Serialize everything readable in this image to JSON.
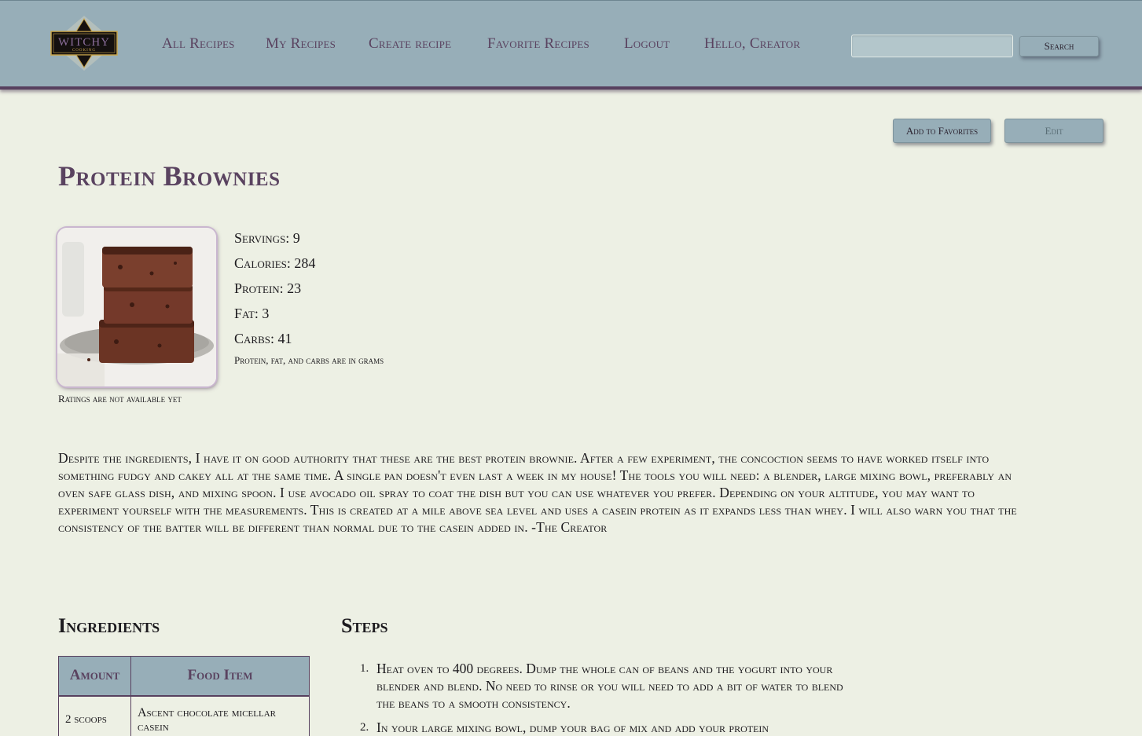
{
  "nav": {
    "logo_text": "Witchy Cooking",
    "links": [
      "All Recipes",
      "My Recipes",
      "Create recipe",
      "Favorite Recipes",
      "Logout",
      "Hello, Creator"
    ],
    "search_placeholder": "",
    "search_button": "Search"
  },
  "actions": {
    "favorite": "Add to Favorites",
    "edit": "Edit"
  },
  "recipe": {
    "title": "Protein Brownies",
    "ratings": "Ratings are not available yet",
    "stats": {
      "servings": "Servings: 9",
      "calories": "Calories: 284",
      "protein": "Protein: 23",
      "fat": "Fat: 3",
      "carbs": "Carbs: 41",
      "note": "Protein, fat, and carbs are in grams"
    },
    "description": "Despite the ingredients, I have it on good authority that these are the best protein brownie. After a few experiment, the concoction seems to have worked itself into something fudgy and cakey all at the same time. A single pan doesn't even last a week in my house! The tools you will need: a blender, large mixing bowl, preferably an oven safe glass dish, and mixing spoon. I use avocado oil spray to coat the dish but you can use whatever you prefer. Depending on your altitude, you may want to experiment yourself with the measurements. This is created at a mile above sea level and uses a casein protein as it expands less than whey. I will also warn you that the consistency of the batter will be different than normal due to the casein added in. -The Creator"
  },
  "ingredients": {
    "heading": "Ingredients",
    "columns": [
      "Amount",
      "Food Item"
    ],
    "rows": [
      {
        "amount": "2 scoops",
        "item": "Ascent chocolate micellar casein"
      }
    ]
  },
  "steps": {
    "heading": "Steps",
    "items": [
      {
        "num": "1.",
        "text": "Heat oven to 400 degrees. Dump the whole can of beans and the yogurt into your blender and blend. No need to rinse or you will need to add a bit of water to blend the beans to a smooth consistency."
      },
      {
        "num": "2.",
        "text": "In your large mixing bowl, dump your bag of mix and add your protein"
      }
    ]
  }
}
